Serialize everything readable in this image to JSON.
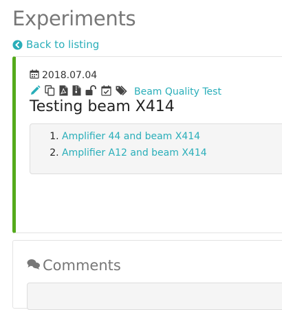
{
  "page": {
    "title": "Experiments",
    "back_link": "Back to listing"
  },
  "experiment": {
    "date": "2018.07.04",
    "tag": "Beam Quality Test",
    "title": "Testing beam X414",
    "accent_color": "#54aa1b",
    "action_icons": [
      "pencil-icon",
      "duplicate-icon",
      "pdf-icon",
      "zip-file-icon",
      "lock-icon",
      "timestamp-icon",
      "tags-icon"
    ],
    "linked_items": [
      "Amplifier 44 and beam X414",
      "Amplifier A12 and beam X414"
    ]
  },
  "comments": {
    "title": "Comments"
  },
  "colors": {
    "link": "#29aeb9",
    "muted_heading": "#777777"
  }
}
